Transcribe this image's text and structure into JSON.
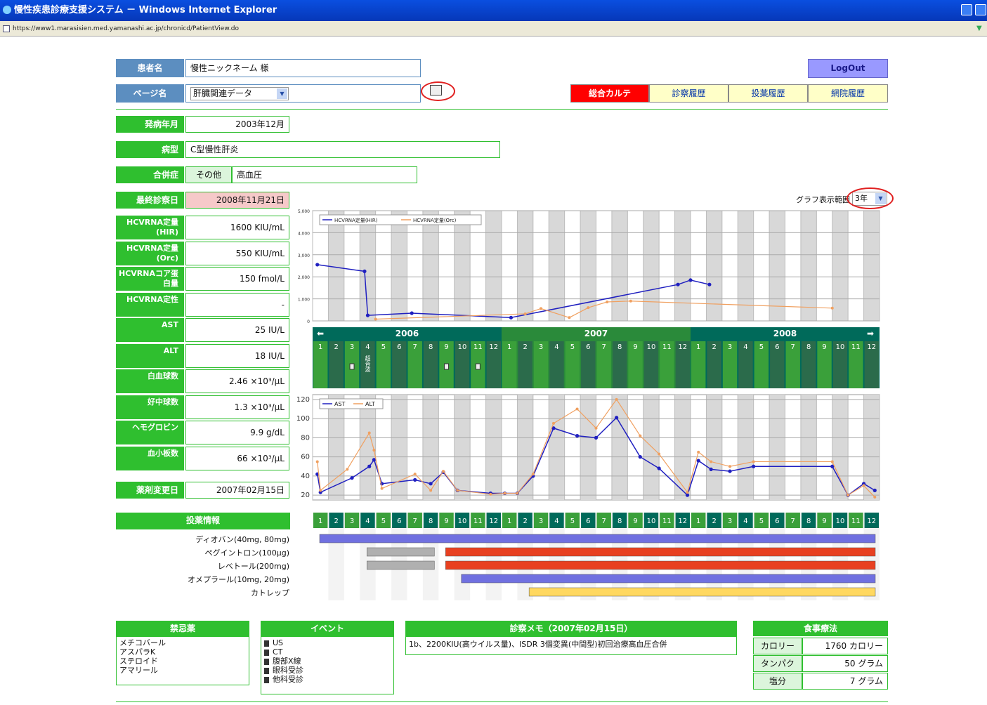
{
  "window": {
    "title": "慢性疾患診療支援システム － Windows Internet Explorer",
    "url": "https://www1.marasisien.med.yamanashi.ac.jp/chronicd/PatientView.do"
  },
  "patient": {
    "name_label": "患者名",
    "name_value": "慢性ニックネーム 様",
    "page_label": "ページ名",
    "page_value": "肝臓関連データ"
  },
  "logout": "LogOut",
  "tabs": [
    {
      "label": "総合カルテ",
      "active": true
    },
    {
      "label": "診察履歴"
    },
    {
      "label": "投薬履歴"
    },
    {
      "label": "網院履歴"
    }
  ],
  "info": {
    "onset_label": "発病年月",
    "onset_value": "2003年12月",
    "disease_label": "病型",
    "disease_value": "C型慢性肝炎",
    "comp_label": "合併症",
    "comp_other": "その他",
    "comp_value": "高血圧",
    "last_label": "最終診察日",
    "last_value": "2008年11月21日"
  },
  "labs": [
    {
      "label": "HCVRNA定量(HIR)",
      "value": "1600 KIU/mL"
    },
    {
      "label": "HCVRNA定量(Orc)",
      "value": "550 KIU/mL"
    },
    {
      "label": "HCVRNAコア蛋白量",
      "value": "150 fmol/L"
    },
    {
      "label": "HCVRNA定性",
      "value": "-"
    },
    {
      "label": "AST",
      "value": "25 IU/L"
    },
    {
      "label": "ALT",
      "value": "18 IU/L"
    },
    {
      "label": "白血球数",
      "value": "2.46 ×10³/μL"
    },
    {
      "label": "好中球数",
      "value": "1.3 ×10³/μL"
    },
    {
      "label": "ヘモグロビン",
      "value": "9.9 g/dL"
    },
    {
      "label": "血小板数",
      "value": "66 ×10³/μL"
    }
  ],
  "drug_change": {
    "label": "薬剤変更日",
    "value": "2007年02月15日"
  },
  "graph_range": {
    "label": "グラフ表示範囲",
    "value": "3年"
  },
  "timeline": {
    "years": [
      "2006",
      "2007",
      "2008"
    ],
    "months": [
      "1",
      "2",
      "3",
      "4",
      "5",
      "6",
      "7",
      "8",
      "9",
      "10",
      "11",
      "12",
      "1",
      "2",
      "3",
      "4",
      "5",
      "6",
      "7",
      "8",
      "9",
      "10",
      "11",
      "12",
      "1",
      "2",
      "3",
      "4",
      "5",
      "6",
      "7",
      "8",
      "9",
      "10",
      "11",
      "12"
    ],
    "event_col4": "超音波"
  },
  "chart_data": [
    {
      "type": "line",
      "yticks": [
        "0",
        "1,000",
        "2,000",
        "3,000",
        "4,000",
        "5,000"
      ],
      "ylim": [
        0,
        5000
      ],
      "series": [
        {
          "name": "HCVRNA定量(HIR)",
          "color": "#2020c0",
          "points": [
            [
              0.3,
              2550
            ],
            [
              3.3,
              2250
            ],
            [
              3.5,
              250
            ],
            [
              6.3,
              350
            ],
            [
              12.6,
              150
            ],
            [
              23.2,
              1650
            ],
            [
              24.0,
              1850
            ],
            [
              25.2,
              1650
            ]
          ]
        },
        {
          "name": "HCVRNA定量(Orc)",
          "color": "#f0a060",
          "points": [
            [
              4.0,
              80
            ],
            [
              13.5,
              320
            ],
            [
              14.5,
              560
            ],
            [
              16.3,
              150
            ],
            [
              17.5,
              600
            ],
            [
              18.7,
              860
            ],
            [
              20.2,
              900
            ],
            [
              33.0,
              580
            ]
          ]
        }
      ]
    },
    {
      "type": "line",
      "yticks": [
        "20",
        "40",
        "60",
        "80",
        "100",
        "120"
      ],
      "ylim": [
        15,
        125
      ],
      "series": [
        {
          "name": "AST",
          "color": "#2020c0",
          "points": [
            [
              0.3,
              42
            ],
            [
              0.5,
              23
            ],
            [
              2.5,
              38
            ],
            [
              3.6,
              50
            ],
            [
              3.9,
              57
            ],
            [
              4.4,
              32
            ],
            [
              6.5,
              36
            ],
            [
              7.5,
              32
            ],
            [
              8.3,
              44
            ],
            [
              9.2,
              25
            ],
            [
              11.3,
              22
            ],
            [
              12.2,
              22
            ],
            [
              13.0,
              22
            ],
            [
              14.0,
              40
            ],
            [
              15.3,
              90
            ],
            [
              16.8,
              82
            ],
            [
              18.0,
              80
            ],
            [
              19.3,
              101
            ],
            [
              20.8,
              60
            ],
            [
              22.0,
              48
            ],
            [
              23.8,
              20
            ],
            [
              24.5,
              56
            ],
            [
              25.3,
              47
            ],
            [
              26.5,
              45
            ],
            [
              28.0,
              50
            ],
            [
              33.0,
              50
            ],
            [
              34.0,
              20
            ],
            [
              35.0,
              32
            ],
            [
              35.7,
              25
            ]
          ]
        },
        {
          "name": "ALT",
          "color": "#f0a060",
          "points": [
            [
              0.3,
              55
            ],
            [
              0.5,
              25
            ],
            [
              2.2,
              47
            ],
            [
              3.6,
              85
            ],
            [
              3.9,
              67
            ],
            [
              4.4,
              27
            ],
            [
              6.5,
              42
            ],
            [
              7.5,
              25
            ],
            [
              8.3,
              45
            ],
            [
              9.2,
              25
            ],
            [
              11.3,
              21
            ],
            [
              12.2,
              22
            ],
            [
              13.0,
              22
            ],
            [
              14.0,
              42
            ],
            [
              15.3,
              95
            ],
            [
              16.8,
              110
            ],
            [
              18.0,
              90
            ],
            [
              19.3,
              120
            ],
            [
              20.8,
              82
            ],
            [
              22.0,
              63
            ],
            [
              23.8,
              23
            ],
            [
              24.5,
              65
            ],
            [
              25.3,
              55
            ],
            [
              26.5,
              50
            ],
            [
              28.0,
              55
            ],
            [
              33.0,
              55
            ],
            [
              34.0,
              20
            ],
            [
              35.0,
              30
            ],
            [
              35.7,
              18
            ]
          ]
        }
      ]
    }
  ],
  "medication": {
    "header": "投薬情報",
    "drugs": [
      "ディオバン(40mg, 80mg)",
      "ペグイントロン(100μg)",
      "レベトール(200mg)",
      "オメプラール(10mg, 20mg)",
      "カトレップ"
    ],
    "bars": [
      {
        "row": 0,
        "start": 0,
        "end": 36,
        "color": "#7070e0"
      },
      {
        "row": 1,
        "start": 3,
        "end": 8,
        "color": "#b0b0b0"
      },
      {
        "row": 1,
        "start": 8,
        "end": 36,
        "color": "#e84020"
      },
      {
        "row": 2,
        "start": 3,
        "end": 8,
        "color": "#b0b0b0"
      },
      {
        "row": 2,
        "start": 8,
        "end": 36,
        "color": "#e84020"
      },
      {
        "row": 3,
        "start": 9,
        "end": 36,
        "color": "#7070e0"
      },
      {
        "row": 4,
        "start": 13.3,
        "end": 36,
        "color": "#ffd860"
      }
    ]
  },
  "warnings": {
    "header": "禁忌薬",
    "items": [
      "メチコバール",
      "アスパラK",
      "ステロイド",
      "アマリール"
    ]
  },
  "events": {
    "header": "イベント",
    "items": [
      "US",
      "CT",
      "腹部X線",
      "眼科受診",
      "他科受診"
    ]
  },
  "memo": {
    "header": "診察メモ（2007年02月15日）",
    "text": "1b、2200KIU(高ウイルス量)、ISDR 3個変異(中間型)初回治療高血圧合併"
  },
  "diet": {
    "header": "食事療法",
    "rows": [
      {
        "label": "カロリー",
        "value": "1760 カロリー"
      },
      {
        "label": "タンパク",
        "value": "50 グラム"
      },
      {
        "label": "塩分",
        "value": "7 グラム"
      }
    ]
  },
  "colors": {
    "green": "#2fbf2f",
    "dark_teal": "#006a5a",
    "active_tab": "#ff0000"
  }
}
